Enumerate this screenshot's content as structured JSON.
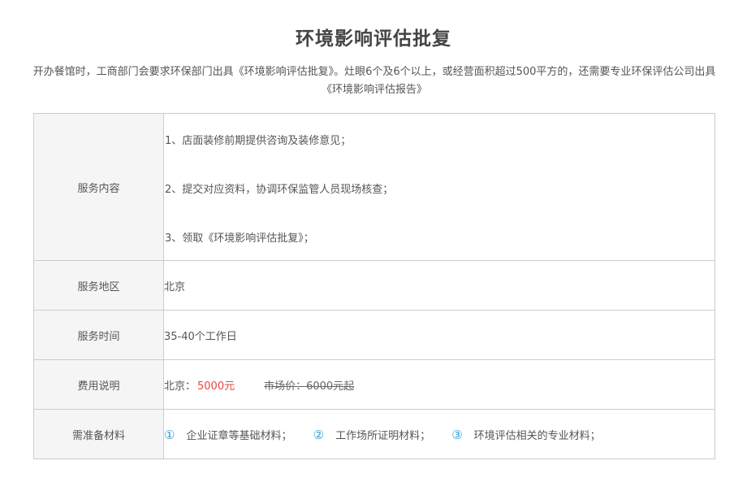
{
  "page": {
    "title": "环境影响评估批复",
    "intro": "开办餐馆时，工商部门会要求环保部门出具《环境影响评估批复》。灶眼6个及6个以上，或经营面积超过500平方的，还需要专业环保评估公司出具《环境影响评估报告》"
  },
  "table": {
    "content_label": "服务内容",
    "content_items": [
      "1、店面装修前期提供咨询及装修意见；",
      "2、提交对应资料，协调环保监管人员现场核查；",
      "3、领取《环境影响评估批复》；"
    ],
    "area_label": "服务地区",
    "area_value": "北京",
    "time_label": "服务时间",
    "time_value": "35-40个工作日",
    "fee_label": "费用说明",
    "fee_city": "北京：",
    "fee_price": "5000元",
    "fee_market": "市场价：6000元起",
    "materials_label": "需准备材料",
    "materials": [
      {
        "mark": "①",
        "text": "企业证章等基础材料；"
      },
      {
        "mark": "②",
        "text": "工作场所证明材料；"
      },
      {
        "mark": "③",
        "text": "环境评估相关的专业材料；"
      }
    ]
  },
  "colors": {
    "price": "#e64545",
    "marker": "#2a9fd6",
    "label_bg": "#f5f5f5",
    "border": "#cccccc"
  }
}
